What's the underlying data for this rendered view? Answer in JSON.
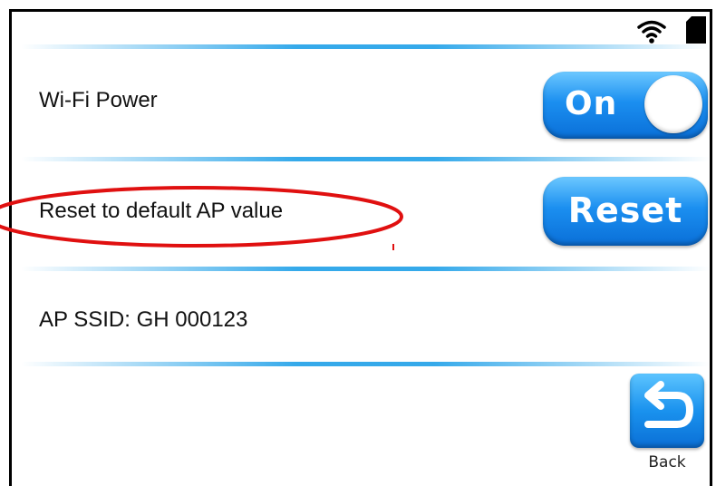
{
  "settings": {
    "wifi_power": {
      "label": "Wi-Fi Power",
      "toggle_label": "On",
      "state": "on"
    },
    "reset_ap": {
      "label": "Reset to default AP value",
      "button_label": "Reset"
    },
    "ap_ssid": {
      "label": "AP SSID: GH 000123"
    }
  },
  "footer": {
    "back_label": "Back"
  },
  "status_bar": {
    "icons": [
      "wifi-icon",
      "sd-card-icon"
    ]
  },
  "colors": {
    "accent_blue": "#1b8ff0",
    "divider_blue": "#1fa0e8",
    "annotation_red": "#e01010"
  }
}
